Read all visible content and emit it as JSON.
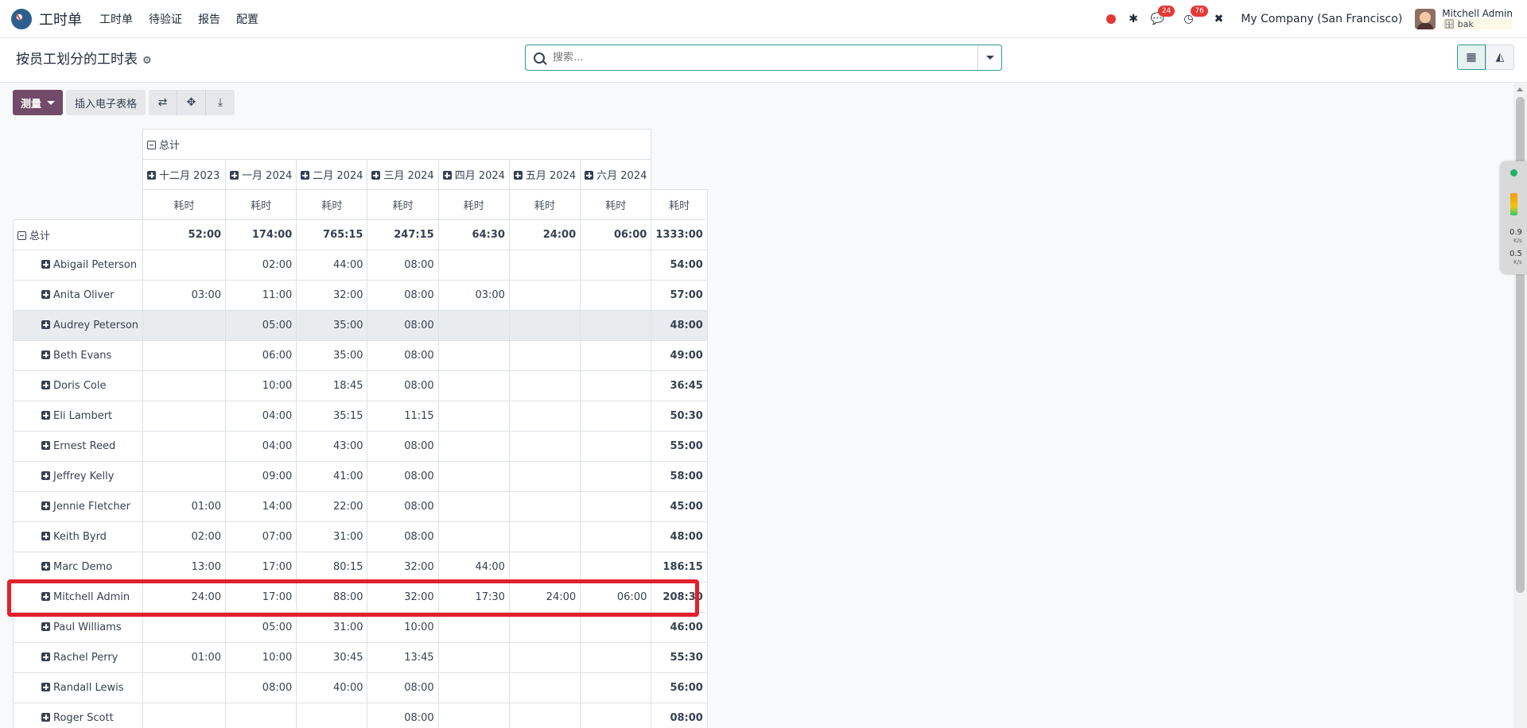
{
  "nav": {
    "app_name": "工时单",
    "menu": [
      "工时单",
      "待验证",
      "报告",
      "配置"
    ],
    "badge_messages": "24",
    "badge_activities": "76",
    "company": "My Company (San Francisco)",
    "user_name": "Mitchell Admin",
    "user_db": "bak"
  },
  "control_panel": {
    "title": "按员工划分的工时表",
    "search_placeholder": "搜索..."
  },
  "toolbar": {
    "measure_label": "测量",
    "insert_sheet_label": "插入电子表格"
  },
  "pivot": {
    "col_group_label": "总计",
    "months": [
      "十二月 2023",
      "一月 2024",
      "二月 2024",
      "三月 2024",
      "四月 2024",
      "五月 2024",
      "六月 2024"
    ],
    "measure_label": "耗时",
    "grand": {
      "label": "总计",
      "values": [
        "52:00",
        "174:00",
        "765:15",
        "247:15",
        "64:30",
        "24:00",
        "06:00"
      ],
      "total": "1333:00"
    },
    "rows": [
      {
        "name": "Abigail Peterson",
        "values": [
          "",
          "02:00",
          "44:00",
          "08:00",
          "",
          "",
          ""
        ],
        "total": "54:00"
      },
      {
        "name": "Anita Oliver",
        "values": [
          "03:00",
          "11:00",
          "32:00",
          "08:00",
          "03:00",
          "",
          ""
        ],
        "total": "57:00"
      },
      {
        "name": "Audrey Peterson",
        "values": [
          "",
          "05:00",
          "35:00",
          "08:00",
          "",
          "",
          ""
        ],
        "total": "48:00"
      },
      {
        "name": "Beth Evans",
        "values": [
          "",
          "06:00",
          "35:00",
          "08:00",
          "",
          "",
          ""
        ],
        "total": "49:00"
      },
      {
        "name": "Doris Cole",
        "values": [
          "",
          "10:00",
          "18:45",
          "08:00",
          "",
          "",
          ""
        ],
        "total": "36:45"
      },
      {
        "name": "Eli Lambert",
        "values": [
          "",
          "04:00",
          "35:15",
          "11:15",
          "",
          "",
          ""
        ],
        "total": "50:30"
      },
      {
        "name": "Ernest Reed",
        "values": [
          "",
          "04:00",
          "43:00",
          "08:00",
          "",
          "",
          ""
        ],
        "total": "55:00"
      },
      {
        "name": "Jeffrey Kelly",
        "values": [
          "",
          "09:00",
          "41:00",
          "08:00",
          "",
          "",
          ""
        ],
        "total": "58:00"
      },
      {
        "name": "Jennie Fletcher",
        "values": [
          "01:00",
          "14:00",
          "22:00",
          "08:00",
          "",
          "",
          ""
        ],
        "total": "45:00"
      },
      {
        "name": "Keith Byrd",
        "values": [
          "02:00",
          "07:00",
          "31:00",
          "08:00",
          "",
          "",
          ""
        ],
        "total": "48:00"
      },
      {
        "name": "Marc Demo",
        "values": [
          "13:00",
          "17:00",
          "80:15",
          "32:00",
          "44:00",
          "",
          ""
        ],
        "total": "186:15"
      },
      {
        "name": "Mitchell Admin",
        "values": [
          "24:00",
          "17:00",
          "88:00",
          "32:00",
          "17:30",
          "24:00",
          "06:00"
        ],
        "total": "208:30"
      },
      {
        "name": "Paul Williams",
        "values": [
          "",
          "05:00",
          "31:00",
          "10:00",
          "",
          "",
          ""
        ],
        "total": "46:00"
      },
      {
        "name": "Rachel Perry",
        "values": [
          "01:00",
          "10:00",
          "30:45",
          "13:45",
          "",
          "",
          ""
        ],
        "total": "55:30"
      },
      {
        "name": "Randall Lewis",
        "values": [
          "",
          "08:00",
          "40:00",
          "08:00",
          "",
          "",
          ""
        ],
        "total": "56:00"
      },
      {
        "name": "Roger Scott",
        "values": [
          "",
          "",
          "",
          "08:00",
          "",
          "",
          ""
        ],
        "total": "08:00"
      }
    ]
  },
  "widget": {
    "up": "0.9",
    "down": "0.5",
    "unit": "K/s"
  }
}
